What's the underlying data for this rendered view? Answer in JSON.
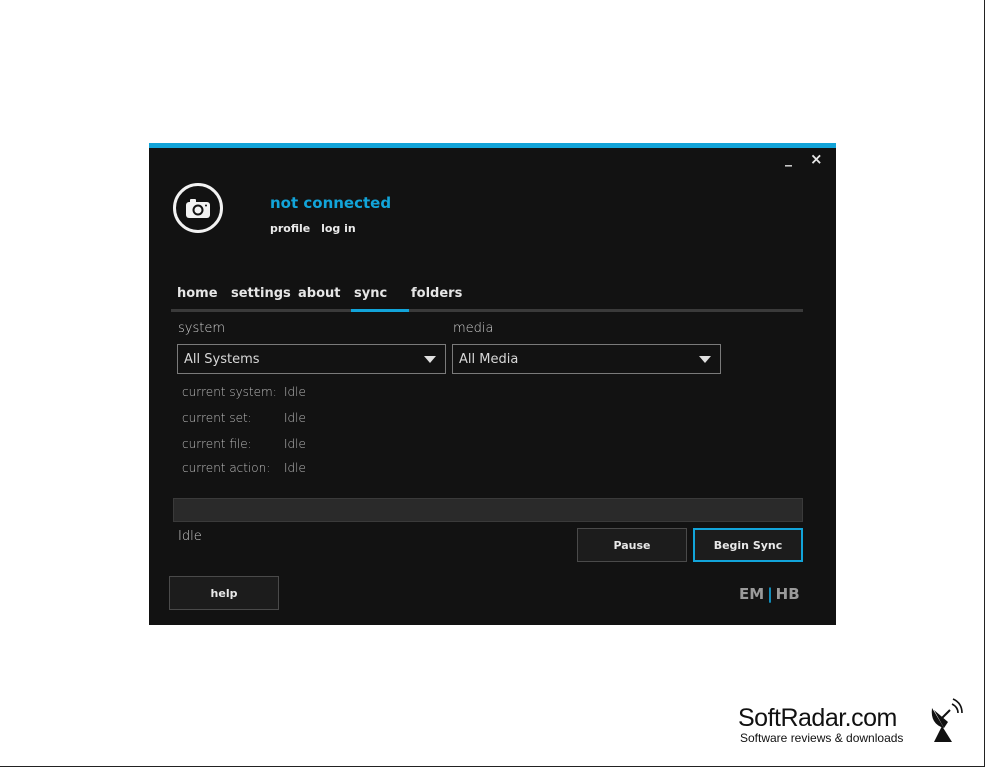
{
  "window": {
    "minimize_label": "_",
    "close_label": "×",
    "accent_color": "#12a4d9"
  },
  "account": {
    "status": "not connected",
    "profile_link": "profile",
    "login_link": "log in",
    "avatar_icon": "camera-icon"
  },
  "tabs": [
    {
      "label": "home",
      "active": false
    },
    {
      "label": "settings",
      "active": false
    },
    {
      "label": "about",
      "active": false
    },
    {
      "label": "sync",
      "active": true
    },
    {
      "label": "folders",
      "active": false
    }
  ],
  "sync": {
    "system_label": "system",
    "system_selected": "All Systems",
    "media_label": "media",
    "media_selected": "All Media",
    "info": [
      {
        "key": "current system:",
        "value": "Idle"
      },
      {
        "key": "current set:",
        "value": "Idle"
      },
      {
        "key": "current file:",
        "value": "Idle"
      },
      {
        "key": "current action:",
        "value": "Idle"
      }
    ],
    "progress_percent": 0,
    "status_text": "Idle",
    "pause_label": "Pause",
    "begin_label": "Begin Sync"
  },
  "footer": {
    "help_label": "help",
    "brand_left": "EM",
    "brand_sep": "|",
    "brand_right": "HB"
  },
  "watermark": {
    "name": "SoftRadar.com",
    "tagline": "Software reviews & downloads",
    "icon": "satellite-dish-icon"
  }
}
